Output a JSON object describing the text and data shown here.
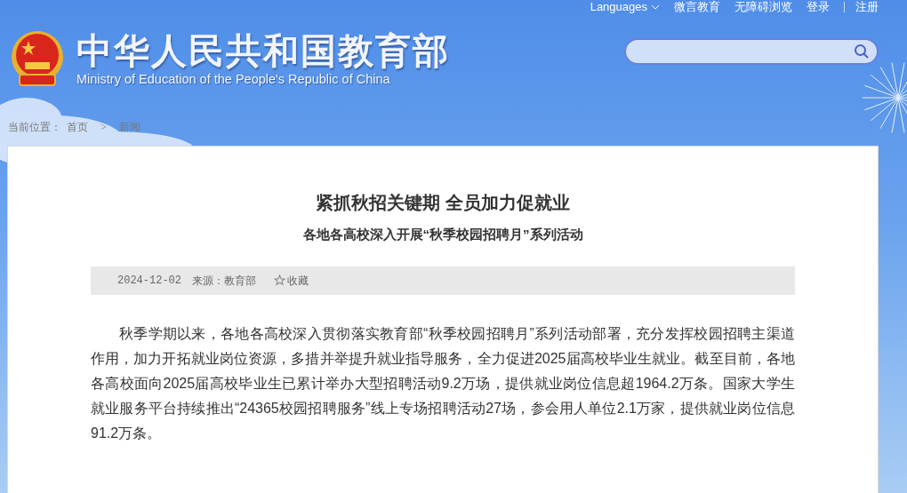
{
  "header": {
    "logo_title": "中华人民共和国教育部",
    "logo_subtitle": "Ministry of Education of the People's Republic of China",
    "top_links": [
      {
        "label": "Languages",
        "kind": "dropdown",
        "separator_before": false
      },
      {
        "label": "微言教育",
        "kind": "link",
        "separator_before": false
      },
      {
        "label": "无障碍浏览",
        "kind": "link",
        "separator_before": false
      },
      {
        "label": "登录",
        "kind": "link",
        "separator_before": false
      },
      {
        "label": "注册",
        "kind": "link",
        "separator_before": true
      }
    ]
  },
  "breadcrumb": {
    "label": "当前位置：",
    "separator": ">",
    "items": [
      {
        "label": "首页"
      },
      {
        "label": "新闻"
      }
    ]
  },
  "article": {
    "title": "紧抓秋招关键期 全员加力促就业",
    "subtitle": "各地各高校深入开展“秋季校园招聘月”系列活动",
    "meta": {
      "date": "2024-12-02",
      "source": "来源：教育部",
      "favorite": "收藏"
    },
    "paragraphs": [
      "秋季学期以来，各地各高校深入贯彻落实教育部“秋季校园招聘月”系列活动部署，充分发挥校园招聘主渠道作用，加力开拓就业岗位资源，多措并举提升就业指导服务，全力促进2025届高校毕业生就业。截至目前，各地各高校面向2025届高校毕业生已累计举办大型招聘活动9.2万场，提供就业岗位信息超1964.2万条。国家大学生就业服务平台持续推出“24365校园招聘服务”线上专场招聘活动27场，参会用人单位2.1万家，提供就业岗位信息91.2万条。"
    ]
  }
}
